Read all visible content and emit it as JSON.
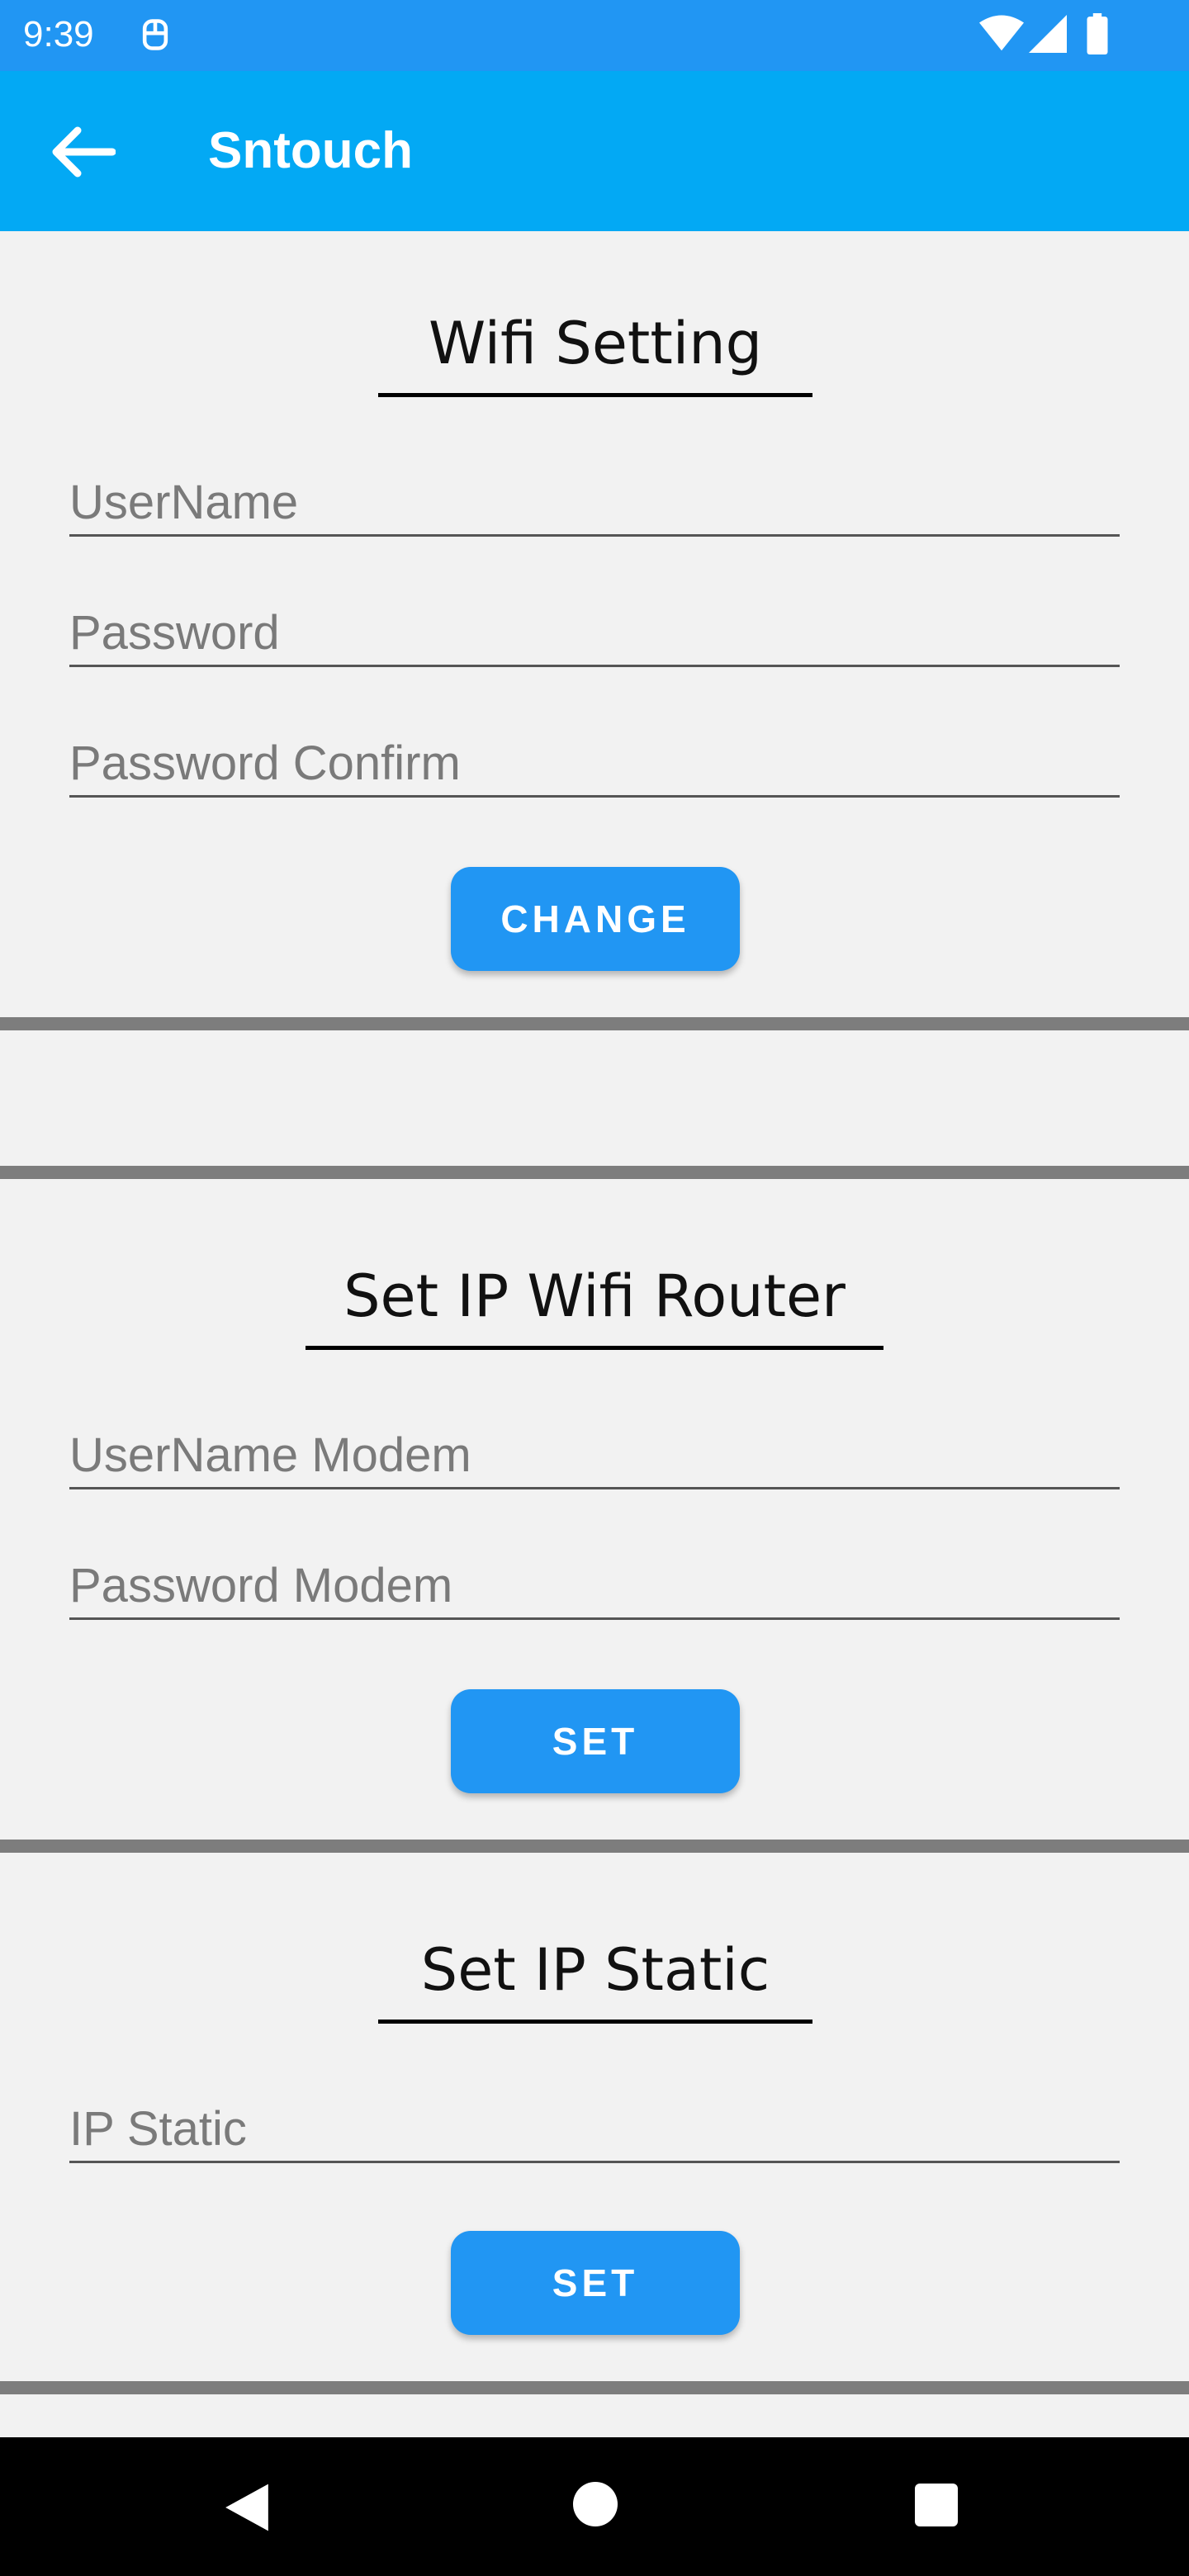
{
  "status_bar": {
    "time": "9:39",
    "icons": [
      "app-notification-icon",
      "wifi-icon",
      "cell-signal-icon",
      "battery-icon"
    ],
    "background": "#2196f3"
  },
  "app_bar": {
    "title": "Sntouch",
    "back_icon": "arrow-back-icon",
    "background": "#03a9f4"
  },
  "wifi_setting": {
    "title": "Wifi Setting",
    "username_placeholder": "UserName",
    "password_placeholder": "Password",
    "password_confirm_placeholder": "Password Confirm",
    "button_label": "CHANGE"
  },
  "router_setting": {
    "title": "Set IP Wifi Router",
    "username_placeholder": "UserName Modem",
    "password_placeholder": "Password Modem",
    "button_label": "SET"
  },
  "static_ip": {
    "title": "Set IP Static",
    "ip_placeholder": "IP Static",
    "button_label": "SET"
  },
  "nav_bar": {
    "icons": [
      "nav-back-icon",
      "nav-home-icon",
      "nav-recents-icon"
    ]
  },
  "colors": {
    "button": "#2196f3",
    "divider": "#7d7d7d",
    "page_background": "#f2f2f2"
  }
}
